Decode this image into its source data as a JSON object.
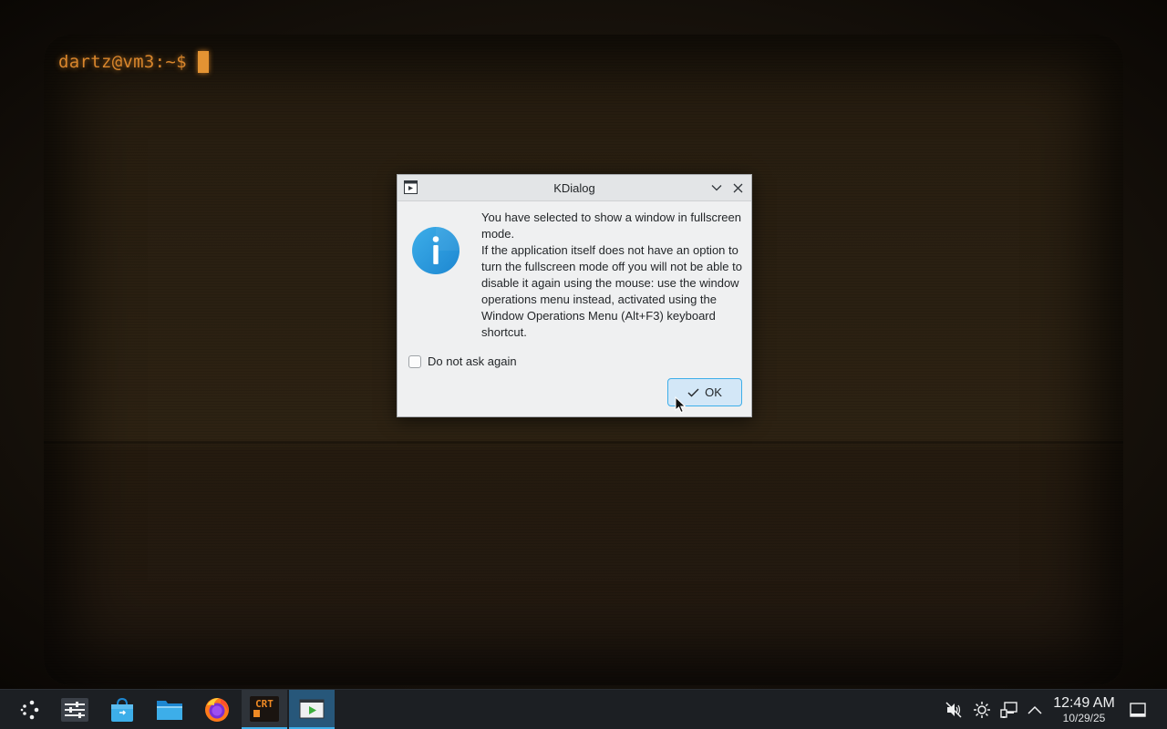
{
  "terminal": {
    "prompt": "dartz@vm3:~$"
  },
  "dialog": {
    "title": "KDialog",
    "message_lines": [
      "You have selected to show a window in fullscreen mode.",
      "If the application itself does not have an option to turn the fullscreen mode off you will not be able to disable it again using the mouse: use the window operations menu instead, activated using the Window Operations Menu (Alt+F3) keyboard shortcut."
    ],
    "checkbox_label": "Do not ask again",
    "checkbox_checked": false,
    "ok_label": "OK",
    "accent_color": "#3daee9"
  },
  "taskbar": {
    "launcher_icon": "kde-launcher-icon",
    "items": [
      {
        "name": "system-settings",
        "icon": "settings-sliders-icon",
        "state": "normal"
      },
      {
        "name": "discover",
        "icon": "store-bag-icon",
        "state": "normal"
      },
      {
        "name": "dolphin",
        "icon": "folder-icon",
        "state": "normal"
      },
      {
        "name": "firefox",
        "icon": "firefox-icon",
        "state": "normal"
      },
      {
        "name": "cool-retro-term",
        "icon": "crt-icon",
        "state": "active",
        "icon_text": "CRT"
      },
      {
        "name": "kdialog",
        "icon": "play-window-icon",
        "state": "focused"
      }
    ],
    "tray": {
      "volume_icon": "volume-muted-icon",
      "brightness_icon": "brightness-icon",
      "network_icon": "network-wired-icon",
      "expand_icon": "chevron-up-icon",
      "show_desktop_icon": "show-desktop-icon"
    },
    "clock": {
      "time": "12:49 AM",
      "date": "10/29/25"
    }
  }
}
